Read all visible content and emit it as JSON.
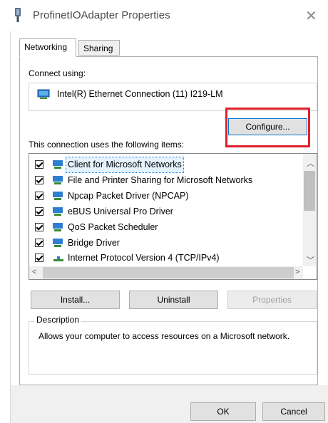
{
  "window": {
    "title": "ProfinetIOAdapter Properties",
    "close_glyph": "✕"
  },
  "tabs": [
    {
      "label": "Networking",
      "active": true
    },
    {
      "label": "Sharing",
      "active": false
    }
  ],
  "networking": {
    "connect_using_label": "Connect using:",
    "adapter_name": "Intel(R) Ethernet Connection (11) I219-LM",
    "adapter_icon": "network-adapter-icon",
    "configure_label": "Configure...",
    "items_label": "This connection uses the following items:",
    "items": [
      {
        "label": "Client for Microsoft Networks",
        "checked": true,
        "icon": "network-client-icon",
        "selected": true
      },
      {
        "label": "File and Printer Sharing for Microsoft Networks",
        "checked": true,
        "icon": "network-service-icon",
        "selected": false
      },
      {
        "label": "Npcap Packet Driver (NPCAP)",
        "checked": true,
        "icon": "network-protocol-icon",
        "selected": false
      },
      {
        "label": "eBUS Universal Pro Driver",
        "checked": true,
        "icon": "network-protocol-icon",
        "selected": false
      },
      {
        "label": "QoS Packet Scheduler",
        "checked": true,
        "icon": "network-service-icon",
        "selected": false
      },
      {
        "label": "Bridge Driver",
        "checked": true,
        "icon": "network-protocol-icon",
        "selected": false
      },
      {
        "label": "Internet Protocol Version 4 (TCP/IPv4)",
        "checked": true,
        "icon": "protocol-icon",
        "selected": false
      }
    ],
    "install_label": "Install...",
    "uninstall_label": "Uninstall",
    "properties_label": "Properties",
    "description_legend": "Description",
    "description_text": "Allows your computer to access resources on a Microsoft network."
  },
  "footer": {
    "ok_label": "OK",
    "cancel_label": "Cancel"
  },
  "colors": {
    "highlight": "#e0202a",
    "accent": "#0078d7"
  }
}
